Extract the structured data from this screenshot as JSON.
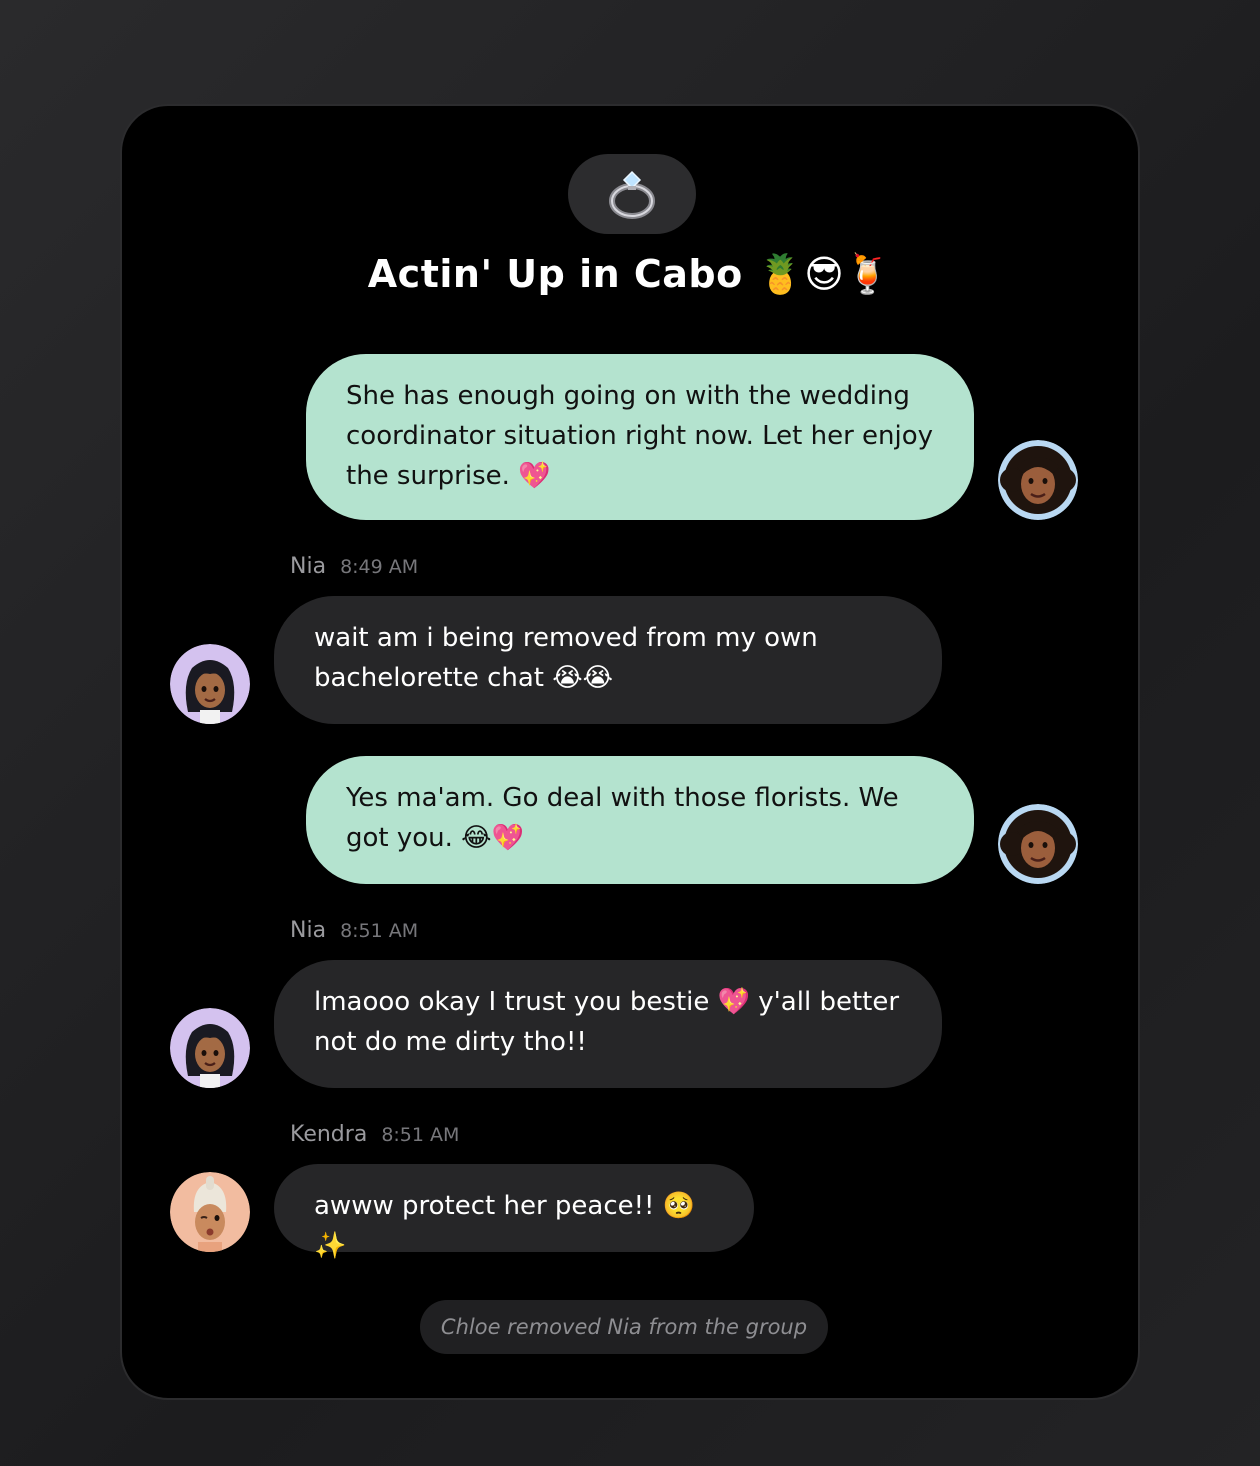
{
  "chat": {
    "group_icon": "ring-icon",
    "title": "Actin' Up in Cabo 🍍😎🍹"
  },
  "messages": [
    {
      "sender": "me",
      "text": "She has enough going on with the wedding coordinator situation right now. Let her enjoy the surprise. 💖"
    },
    {
      "sender": "Nia",
      "time": "8:49 AM",
      "text": "wait am i being removed from my own bachelorette chat 😭😭"
    },
    {
      "sender": "me",
      "text": "Yes ma'am. Go deal with those florists. We got you. 😂💖"
    },
    {
      "sender": "Nia",
      "time": "8:51 AM",
      "text": "lmaooo okay I trust you bestie 💖 y'all better not do me dirty tho!!"
    },
    {
      "sender": "Kendra",
      "time": "8:51 AM",
      "text": "awww protect her peace!! 🥺✨"
    }
  ],
  "system_message": "Chloe removed Nia from the group",
  "colors": {
    "outgoing_bubble": "#b4e3cf",
    "incoming_bubble": "#262628",
    "panel": "#000000"
  }
}
